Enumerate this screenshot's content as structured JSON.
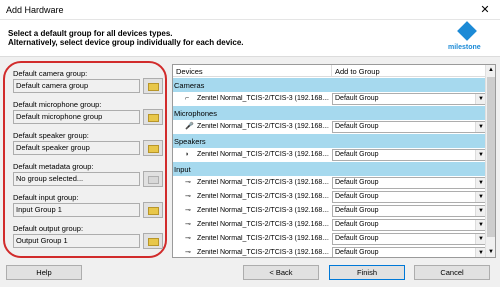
{
  "window": {
    "title": "Add Hardware",
    "close_glyph": "✕"
  },
  "header": {
    "instruction_line1": "Select a default group for all devices types.",
    "instruction_line2": "Alternatively, select device group individually for each device.",
    "logo_text": "milestone",
    "logo_icon": "milestone-diamond-icon"
  },
  "defaults": [
    {
      "label": "Default camera group:",
      "value": "Default camera group",
      "disabled": false
    },
    {
      "label": "Default microphone group:",
      "value": "Default microphone group",
      "disabled": false
    },
    {
      "label": "Default speaker group:",
      "value": "Default speaker group",
      "disabled": false
    },
    {
      "label": "Default metadata group:",
      "value": "No group selected...",
      "disabled": true
    },
    {
      "label": "Default input group:",
      "value": "Input Group 1",
      "disabled": false
    },
    {
      "label": "Default output group:",
      "value": "Output Group 1",
      "disabled": false
    }
  ],
  "grid": {
    "col_devices": "Devices",
    "col_add_to_group": "Add to Group",
    "rows": [
      {
        "kind": "category",
        "name": "Cameras"
      },
      {
        "kind": "device",
        "icon": "camera-icon",
        "glyph": "⌐",
        "name": "Zenitel Normal_TCIS-2/TCIS-3 (192.168....",
        "group": "Default Group"
      },
      {
        "kind": "category",
        "name": "Microphones"
      },
      {
        "kind": "device",
        "icon": "microphone-icon",
        "glyph": "🎤",
        "name": "Zenitel Normal_TCIS-2/TCIS-3 (192.168....",
        "group": "Default Group"
      },
      {
        "kind": "category",
        "name": "Speakers"
      },
      {
        "kind": "device",
        "icon": "speaker-icon",
        "glyph": "◗",
        "name": "Zenitel Normal_TCIS-2/TCIS-3 (192.168....",
        "group": "Default Group"
      },
      {
        "kind": "category",
        "name": "Input"
      },
      {
        "kind": "device",
        "icon": "input-icon",
        "glyph": "⊸",
        "name": "Zenitel Normal_TCIS-2/TCIS-3 (192.168....",
        "group": "Default Group"
      },
      {
        "kind": "device",
        "icon": "input-icon",
        "glyph": "⊸",
        "name": "Zenitel Normal_TCIS-2/TCIS-3 (192.168....",
        "group": "Default Group"
      },
      {
        "kind": "device",
        "icon": "input-icon",
        "glyph": "⊸",
        "name": "Zenitel Normal_TCIS-2/TCIS-3 (192.168....",
        "group": "Default Group"
      },
      {
        "kind": "device",
        "icon": "input-icon",
        "glyph": "⊸",
        "name": "Zenitel Normal_TCIS-2/TCIS-3 (192.168....",
        "group": "Default Group"
      },
      {
        "kind": "device",
        "icon": "input-icon",
        "glyph": "⊸",
        "name": "Zenitel Normal_TCIS-2/TCIS-3 (192.168....",
        "group": "Default Group"
      },
      {
        "kind": "device",
        "icon": "input-icon",
        "glyph": "⊸",
        "name": "Zenitel Normal_TCIS-2/TCIS-3 (192.168....",
        "group": "Default Group"
      },
      {
        "kind": "device",
        "icon": "input-icon",
        "glyph": "⊸",
        "name": "Zenitel Normal_TCIS-2/TCIS-3 (192.168....",
        "group": "Default Group"
      }
    ],
    "dropdown_arrow": "▼",
    "scroll_up": "▲",
    "scroll_down": "▼"
  },
  "footer": {
    "help": "Help",
    "back": "< Back",
    "finish": "Finish",
    "cancel": "Cancel"
  },
  "colors": {
    "highlight": "#d12b2b",
    "category_row": "#a6d9ee",
    "brand": "#1c8ad6"
  }
}
